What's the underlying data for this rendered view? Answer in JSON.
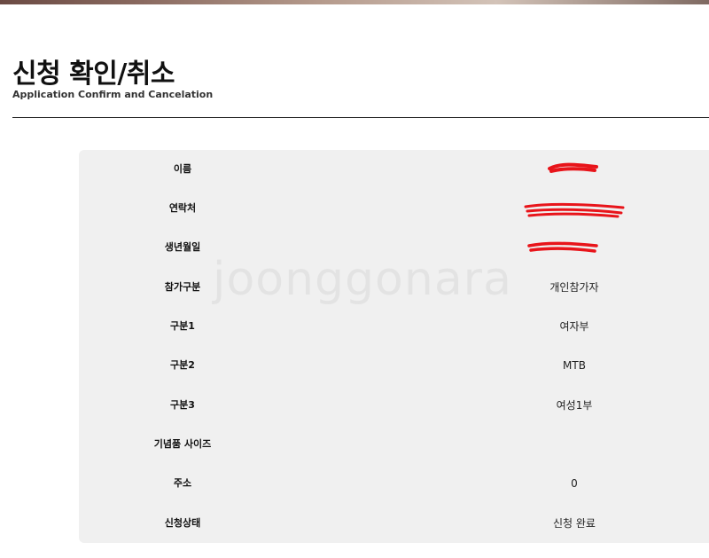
{
  "page": {
    "title": "신청 확인/취소",
    "subtitle": "Application Confirm and Cancelation"
  },
  "watermark": "joonggonara",
  "fields": [
    {
      "label": "이름",
      "value": ""
    },
    {
      "label": "연락처",
      "value": ""
    },
    {
      "label": "생년월일",
      "value": ""
    },
    {
      "label": "참가구분",
      "value": "개인참가자"
    },
    {
      "label": "구분1",
      "value": "여자부"
    },
    {
      "label": "구분2",
      "value": "MTB"
    },
    {
      "label": "구분3",
      "value": "여성1부"
    },
    {
      "label": "기념품 사이즈",
      "value": ""
    },
    {
      "label": "주소",
      "value": "0"
    },
    {
      "label": "신청상태",
      "value": "신청 완료"
    }
  ],
  "colors": {
    "redaction": "#e8141a",
    "panel": "#f0f0f0"
  }
}
